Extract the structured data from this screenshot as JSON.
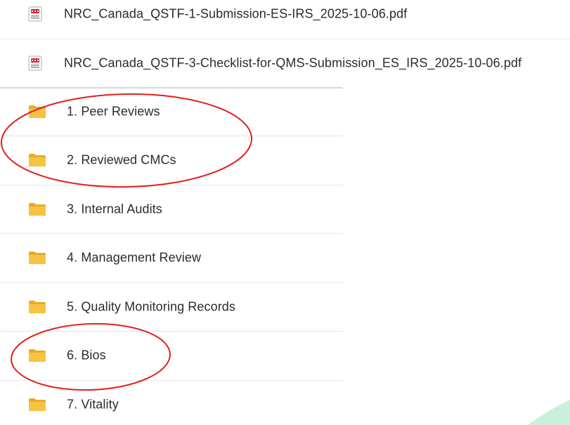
{
  "files": [
    {
      "type": "pdf",
      "name": "NRC_Canada_QSTF-1-Submission-ES-IRS_2025-10-06.pdf",
      "icon": "pdf-icon"
    },
    {
      "type": "pdf",
      "name": "NRC_Canada_QSTF-3-Checklist-for-QMS-Submission_ES_IRS_2025-10-06.pdf",
      "icon": "pdf-icon"
    }
  ],
  "folders": [
    {
      "name": "1. Peer Reviews",
      "icon": "folder-icon",
      "circled": true
    },
    {
      "name": "2. Reviewed CMCs",
      "icon": "folder-icon",
      "circled": true
    },
    {
      "name": "3. Internal Audits",
      "icon": "folder-icon",
      "circled": false
    },
    {
      "name": "4. Management Review",
      "icon": "folder-icon",
      "circled": false
    },
    {
      "name": "5. Quality Monitoring Records",
      "icon": "folder-icon",
      "circled": false
    },
    {
      "name": "6. Bios",
      "icon": "folder-icon",
      "circled": true
    },
    {
      "name": "7. Vitality",
      "icon": "folder-icon",
      "circled": false
    }
  ],
  "colors": {
    "folder": "#f6c342",
    "folder_dark": "#e8ac23",
    "pdf_red": "#d0262d",
    "annotation_red": "#e0201e",
    "text": "#2b2b2b",
    "divider": "#e6e6e6",
    "swoosh": "#c9f0dc"
  }
}
